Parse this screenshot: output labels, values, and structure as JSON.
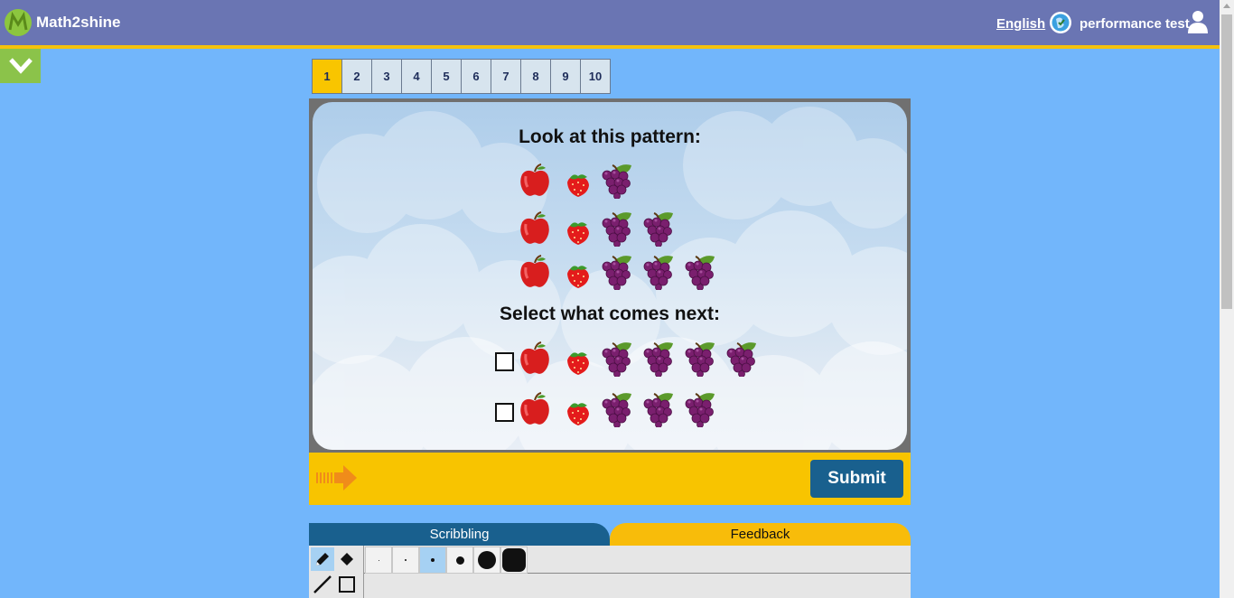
{
  "header": {
    "brand": "Math2shine",
    "language": "English",
    "username": "performance test",
    "colors": {
      "bar": "#6a75b3",
      "accent": "#f4c20d"
    }
  },
  "question_tabs": [
    "1",
    "2",
    "3",
    "4",
    "5",
    "6",
    "7",
    "8",
    "9",
    "10"
  ],
  "active_question": "1",
  "question": {
    "prompt": "Look at this pattern:",
    "pattern_rows": [
      [
        "apple",
        "strawberry",
        "grapes"
      ],
      [
        "apple",
        "strawberry",
        "grapes",
        "grapes"
      ],
      [
        "apple",
        "strawberry",
        "grapes",
        "grapes",
        "grapes"
      ]
    ],
    "select_prompt": "Select what comes next:",
    "options": [
      {
        "fruits": [
          "apple",
          "strawberry",
          "grapes",
          "grapes",
          "grapes",
          "grapes"
        ],
        "checked": false
      },
      {
        "fruits": [
          "apple",
          "strawberry",
          "grapes",
          "grapes",
          "grapes"
        ],
        "checked": false
      }
    ]
  },
  "actions": {
    "submit_label": "Submit"
  },
  "bottom_tabs": {
    "scribbling": "Scribbling",
    "feedback": "Feedback"
  },
  "scribble_tools": {
    "tools": [
      "pencil-icon",
      "eraser-icon",
      "line-icon",
      "rectangle-icon"
    ],
    "selected_tool": "pencil-icon",
    "brush_sizes": [
      "xs",
      "s",
      "m",
      "l",
      "xl",
      "xxl"
    ],
    "selected_size": "m"
  }
}
